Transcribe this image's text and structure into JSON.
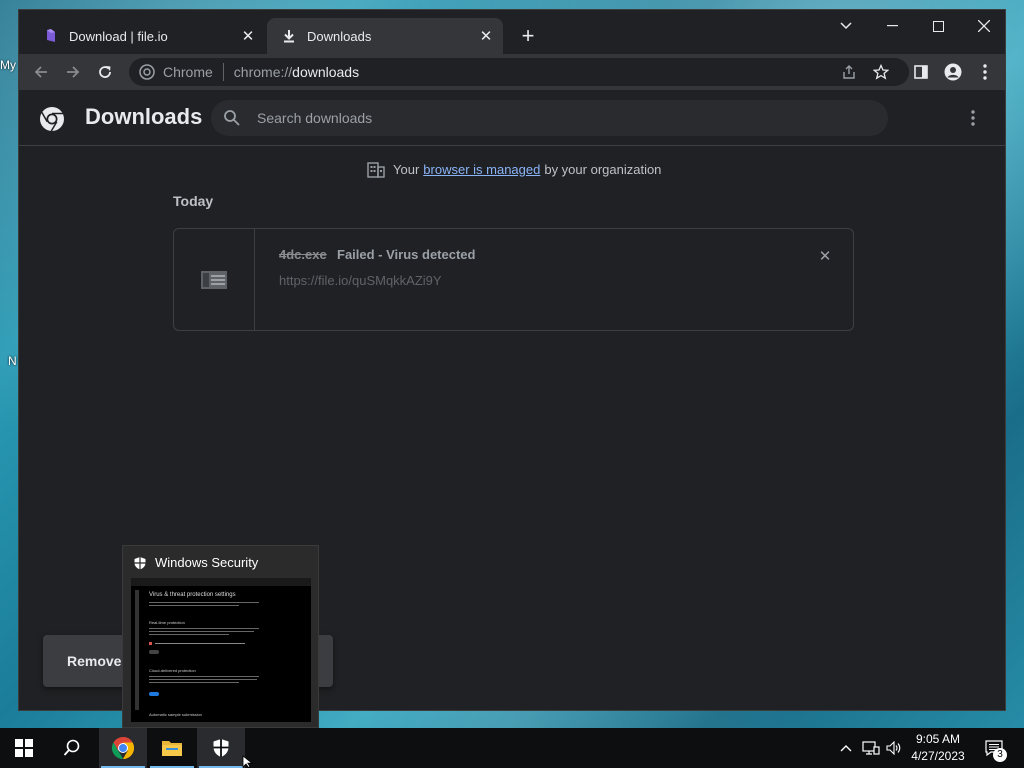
{
  "browser": {
    "tabs": [
      {
        "title": "Download | file.io",
        "favicon": "file-io-icon"
      },
      {
        "title": "Downloads",
        "favicon": "download-icon"
      }
    ],
    "omnibox": {
      "chip": "Chrome",
      "url_scheme": "chrome://",
      "url_host": "downloads"
    }
  },
  "downloads_page": {
    "title": "Downloads",
    "search_placeholder": "Search downloads",
    "managed_prefix": "Your",
    "managed_link": "browser is managed",
    "managed_suffix": "by your organization",
    "date_heading": "Today",
    "item": {
      "file_name": "4dc.exe",
      "status": "Failed - Virus detected",
      "url": "https://file.io/quSMqkkAZi9Y"
    },
    "toast_text": "Removed"
  },
  "taskbar_preview": {
    "title": "Windows Security",
    "thumb_heading": "Virus & threat protection settings",
    "thumb_rt": "Real-time protection",
    "thumb_cloud": "Cloud-delivered protection",
    "thumb_auto": "Automatic sample submission"
  },
  "clock": {
    "time": "9:05 AM",
    "date": "4/27/2023"
  },
  "notification_count": "3",
  "desktop_fragments": {
    "f1": "My",
    "f2": "N"
  },
  "colors": {
    "accent": "#8ab4f8",
    "background": "#202124",
    "toolbar": "#35363a"
  }
}
